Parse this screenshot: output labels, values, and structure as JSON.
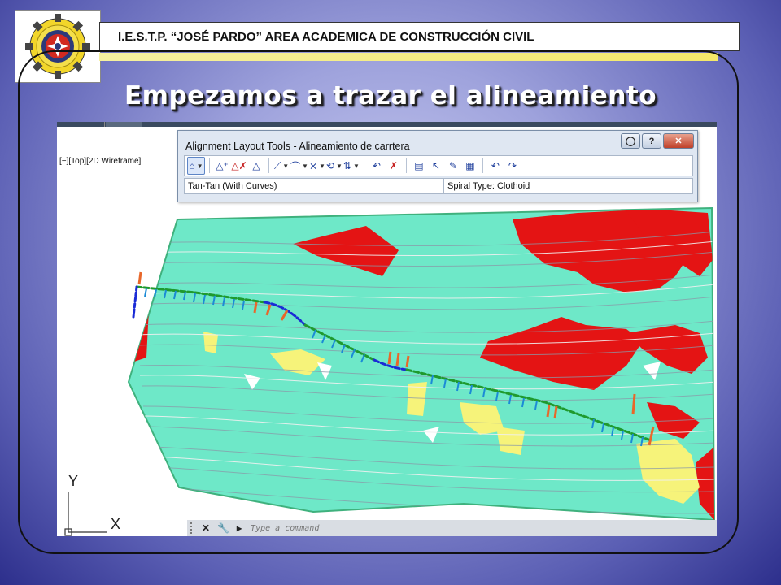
{
  "header": {
    "banner_text": "I.E.S.T.P. “JOSÉ PARDO” AREA ACADEMICA DE CONSTRUCCIÓN CIVIL",
    "logo_icon": "institute-gear-emblem-icon"
  },
  "slide": {
    "title": "Empezamos a trazar el alineamiento"
  },
  "cad": {
    "viewport_label": "[−][Top][2D Wireframe]",
    "dialog": {
      "title": "Alignment Layout Tools - Alineamiento de carrtera",
      "help_label": "?",
      "close_label": "✕",
      "tools": [
        {
          "name": "pi-tool-icon",
          "glyph": "⌂",
          "dropdown": true
        },
        {
          "name": "insert-pi-icon",
          "glyph": "△⁺"
        },
        {
          "name": "delete-pi-icon",
          "glyph": "△✗"
        },
        {
          "name": "break-apart-pi-icon",
          "glyph": "△"
        },
        {
          "name": "tangent-tool-icon",
          "glyph": "⟋",
          "dropdown": true
        },
        {
          "name": "curve-tool-icon",
          "glyph": "⌒",
          "dropdown": true
        },
        {
          "name": "tangent-curve-icon",
          "glyph": "⨯",
          "dropdown": true
        },
        {
          "name": "spiral-tool-icon",
          "glyph": "⟲",
          "dropdown": true
        },
        {
          "name": "reverse-sub-entity-icon",
          "glyph": "⇅"
        },
        {
          "name": "convert-line-icon",
          "glyph": "↶"
        },
        {
          "name": "delete-sub-entity-icon",
          "glyph": "✗"
        },
        {
          "name": "edit-best-fit-icon",
          "glyph": "▤"
        },
        {
          "name": "pick-sub-entity-icon",
          "glyph": "↖"
        },
        {
          "name": "sub-entity-editor-icon",
          "glyph": "✎"
        },
        {
          "name": "alignment-grid-view-icon",
          "glyph": "▦"
        },
        {
          "name": "undo-icon",
          "glyph": "↶"
        },
        {
          "name": "redo-icon",
          "glyph": "↷"
        }
      ],
      "status_left": "Tan-Tan (With Curves)",
      "status_right": "Spiral Type: Clothoid"
    },
    "axis": {
      "y_label": "Y",
      "x_label": "X"
    },
    "command": {
      "placeholder": "Type a command",
      "close_glyph": "✕",
      "settings_glyph": "🔧",
      "prompt_glyph": "▸"
    },
    "colors": {
      "terrain": "#6ee8c8",
      "steep_slope": "#e41414",
      "flat_area": "#f6f37a",
      "alignment_tangent": "#1f9a2e",
      "alignment_curve": "#1a2bd6",
      "station_ticks": "#1b8bd6"
    }
  }
}
